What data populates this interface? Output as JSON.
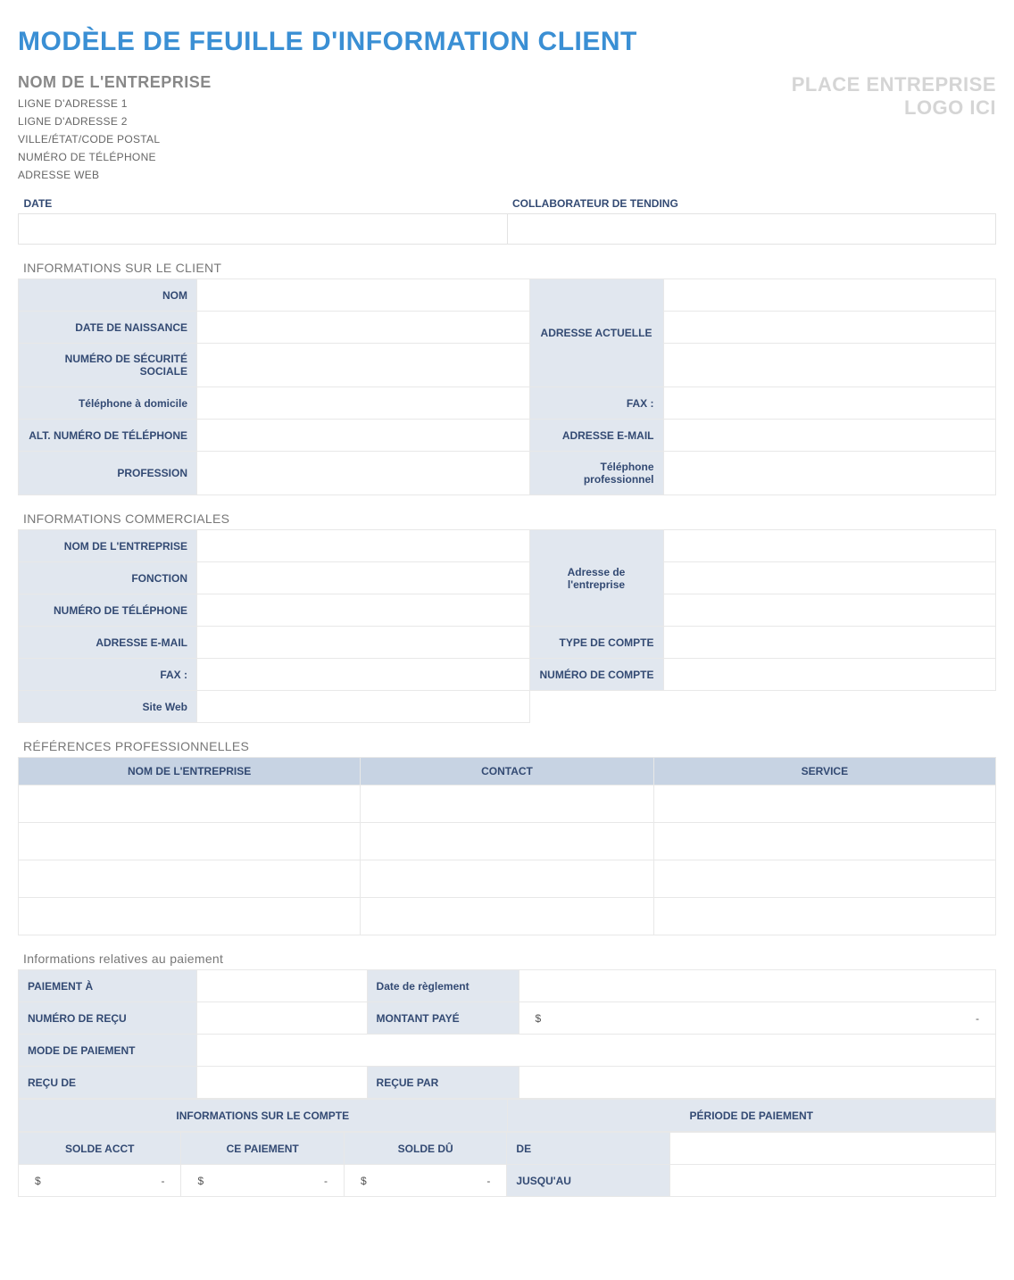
{
  "title": "MODÈLE DE FEUILLE D'INFORMATION CLIENT",
  "company": {
    "name": "NOM DE L'ENTREPRISE",
    "addr1": "LIGNE D'ADRESSE 1",
    "addr2": "LIGNE D'ADRESSE 2",
    "citystate": "VILLE/ÉTAT/CODE POSTAL",
    "phone": "NUMÉRO DE TÉLÉPHONE",
    "web": "ADRESSE WEB"
  },
  "logo": {
    "line1": "PLACE ENTREPRISE",
    "line2": "LOGO ICI"
  },
  "top": {
    "date_label": "DATE",
    "collab_label": "COLLABORATEUR DE TENDING"
  },
  "client": {
    "heading": "INFORMATIONS SUR LE CLIENT",
    "name": "NOM",
    "dob": "DATE DE NAISSANCE",
    "ssn": "NUMÉRO DE SÉCURITÉ SOCIALE",
    "current_address": "ADRESSE ACTUELLE",
    "home_phone": "Téléphone à domicile",
    "fax": "FAX :",
    "alt_phone": "ALT. NUMÉRO DE TÉLÉPHONE",
    "email": "ADRESSE E-MAIL",
    "profession": "PROFESSION",
    "work_phone": "Téléphone professionnel"
  },
  "business": {
    "heading": "INFORMATIONS COMMERCIALES",
    "company": "NOM DE L'ENTREPRISE",
    "function": "FONCTION",
    "phone": "NUMÉRO DE TÉLÉPHONE",
    "address": "Adresse de l'entreprise",
    "email": "ADRESSE E-MAIL",
    "account_type": "TYPE DE COMPTE",
    "fax": "FAX :",
    "account_number": "NUMÉRO DE COMPTE",
    "website": "Site Web"
  },
  "references": {
    "heading": "RÉFÉRENCES PROFESSIONNELLES",
    "col_company": "NOM DE L'ENTREPRISE",
    "col_contact": "CONTACT",
    "col_service": "SERVICE"
  },
  "payment": {
    "heading": "Informations relatives au paiement",
    "pay_to": "PAIEMENT À",
    "settle_date": "Date de règlement",
    "receipt_no": "NUMÉRO DE REÇU",
    "amount_paid": "MONTANT PAYÉ",
    "pay_mode": "MODE DE PAIEMENT",
    "received_from": "REÇU DE",
    "received_by": "REÇUE PAR",
    "account_info": "INFORMATIONS SUR LE COMPTE",
    "pay_period": "PÉRIODE DE PAIEMENT",
    "acct_balance": "SOLDE ACCT",
    "this_payment": "CE PAIEMENT",
    "balance_due": "SOLDE DÛ",
    "from": "DE",
    "until": "JUSQU'AU",
    "currency_symbol": "$",
    "dash": "-"
  }
}
